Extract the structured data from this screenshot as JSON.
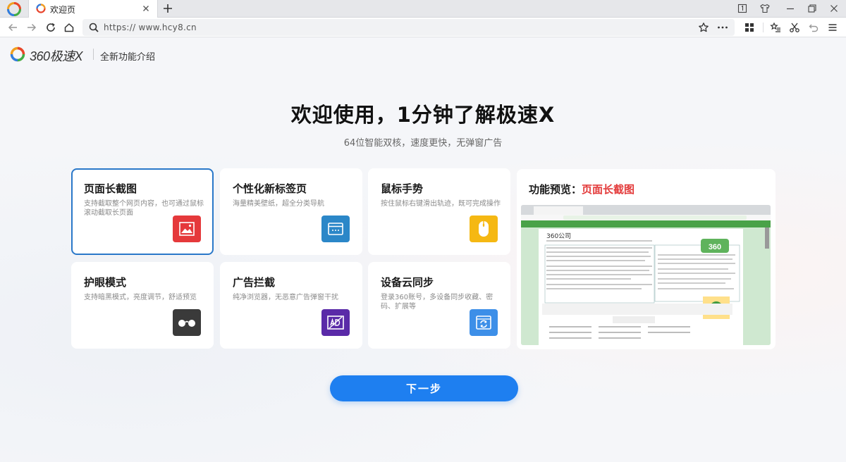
{
  "tab": {
    "title": "欢迎页"
  },
  "address": {
    "url": "https:// www.hcy8.cn"
  },
  "brand": {
    "name": "360极速X",
    "subtitle": "全新功能介绍"
  },
  "hero": {
    "title": "欢迎使用，1分钟了解极速X",
    "subtitle": "64位智能双核，速度更快，无弹窗广告"
  },
  "features": [
    {
      "title": "页面长截图",
      "desc": "支持截取整个网页内容，也可通过鼠标滚动截取长页面",
      "icon": "image-icon",
      "color": "#e5393b"
    },
    {
      "title": "个性化新标签页",
      "desc": "海量精美壁纸，超全分类导航",
      "icon": "window-icon",
      "color": "#2b87c8"
    },
    {
      "title": "鼠标手势",
      "desc": "按住鼠标右键滑出轨迹，既可完成操作",
      "icon": "mouse-icon",
      "color": "#f5b813"
    },
    {
      "title": "护眼模式",
      "desc": "支持暗黑模式，亮度调节，舒适预览",
      "icon": "glasses-icon",
      "color": "#3a3a3a"
    },
    {
      "title": "广告拦截",
      "desc": "纯净浏览器，无恶意广告弹窗干扰",
      "icon": "ad-block-icon",
      "color": "#5a2aa8"
    },
    {
      "title": "设备云同步",
      "desc": "登录360账号，多设备同步收藏、密码、扩展等",
      "icon": "sync-icon",
      "color": "#3d8fe8"
    }
  ],
  "preview": {
    "label": "功能预览：",
    "highlight": "页面长截图",
    "site_title": "360公司",
    "site_logo": "360"
  },
  "next_button": "下一步"
}
